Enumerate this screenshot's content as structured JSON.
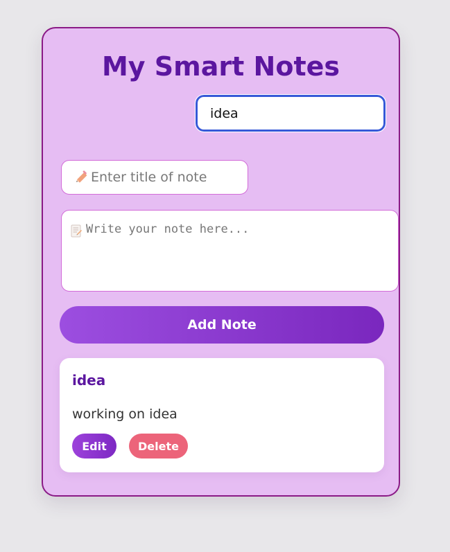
{
  "app": {
    "title": "My Smart Notes"
  },
  "search": {
    "value": "idea"
  },
  "form": {
    "title_placeholder": "Enter title of note",
    "note_placeholder": "Write your note here...",
    "add_label": "Add Note",
    "title_icon": "pencil-icon",
    "note_icon": "memo-icon"
  },
  "notes": [
    {
      "title": "idea",
      "body": "working on idea",
      "edit_label": "Edit",
      "delete_label": "Delete"
    }
  ],
  "colors": {
    "page_background": "#e8e7ea",
    "card_background": "#e6bdf3",
    "card_border": "#8a1a86",
    "title": "#5b169f",
    "search_focus_border": "#3659d8",
    "primary_button": "#8b36d0",
    "delete_button": "#ec647a"
  }
}
